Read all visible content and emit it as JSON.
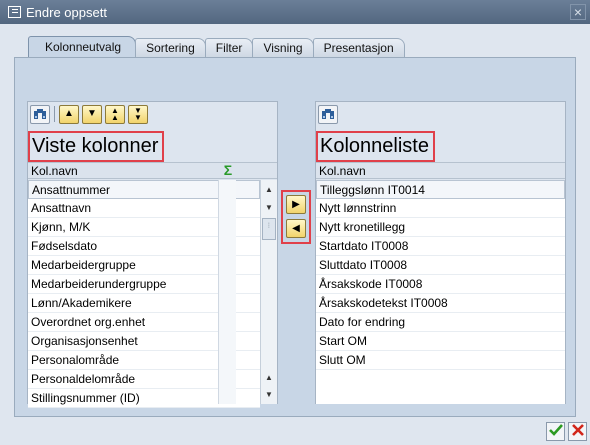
{
  "window": {
    "title": "Endre oppsett",
    "close_glyph": "×"
  },
  "tabs": [
    {
      "label": "Kolonneutvalg",
      "active": true
    },
    {
      "label": "Sortering",
      "active": false
    },
    {
      "label": "Filter",
      "active": false
    },
    {
      "label": "Visning",
      "active": false
    },
    {
      "label": "Presentasjon",
      "active": false
    }
  ],
  "left_panel": {
    "heading": "Viste kolonner",
    "column_header": "Kol.navn",
    "toolbar_icons": [
      "binoculars-icon",
      "scroll-top-icon",
      "scroll-up-icon",
      "scroll-page-up-icon",
      "scroll-bottom-icon"
    ],
    "rows": [
      "Ansattnummer",
      "Ansattnavn",
      "Kjønn, M/K",
      "Fødselsdato",
      "Medarbeidergruppe",
      "Medarbeiderundergruppe",
      "Lønn/Akademikere",
      "Overordnet org.enhet",
      "Organisasjonsenhet",
      "Personalområde",
      "Personaldelområde",
      "Stillingsnummer (ID)"
    ]
  },
  "right_panel": {
    "heading": "Kolonneliste",
    "column_header": "Kol.navn",
    "rows": [
      "Tilleggslønn IT0014",
      "Nytt lønnstrinn",
      "Nytt kronetillegg",
      "Startdato IT0008",
      "Sluttdato IT0008",
      "Årsakskode IT0008",
      "Årsakskodetekst IT0008",
      "Dato for endring",
      "Start OM",
      "Slutt OM"
    ]
  },
  "colors": {
    "highlight": "#e0404a",
    "button_yellow": "#f2d46c",
    "ok_green": "#2c9a22",
    "cancel_red": "#d2261a"
  }
}
